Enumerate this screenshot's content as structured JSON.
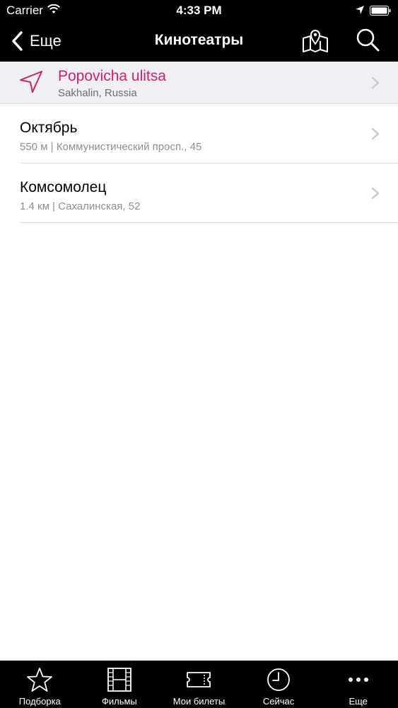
{
  "status_bar": {
    "carrier": "Carrier",
    "time": "4:33 PM"
  },
  "nav": {
    "back_label": "Еще",
    "title": "Кинотеатры"
  },
  "current_location": {
    "name": "Popovicha ulitsa",
    "sub": "Sakhalin, Russia"
  },
  "cinemas": [
    {
      "name": "Октябрь",
      "sub": "550 м | Коммунистический просп., 45"
    },
    {
      "name": "Комсомолец",
      "sub": "1.4 км | Сахалинская, 52"
    }
  ],
  "tabs": [
    {
      "label": "Подборка",
      "icon": "star-icon"
    },
    {
      "label": "Фильмы",
      "icon": "film-icon"
    },
    {
      "label": "Мои билеты",
      "icon": "ticket-icon"
    },
    {
      "label": "Сейчас",
      "icon": "clock-icon"
    },
    {
      "label": "Еще",
      "icon": "more-icon"
    }
  ],
  "colors": {
    "accent": "#d11e6c",
    "bar": "#000000",
    "current_row_bg": "#efeff4"
  }
}
